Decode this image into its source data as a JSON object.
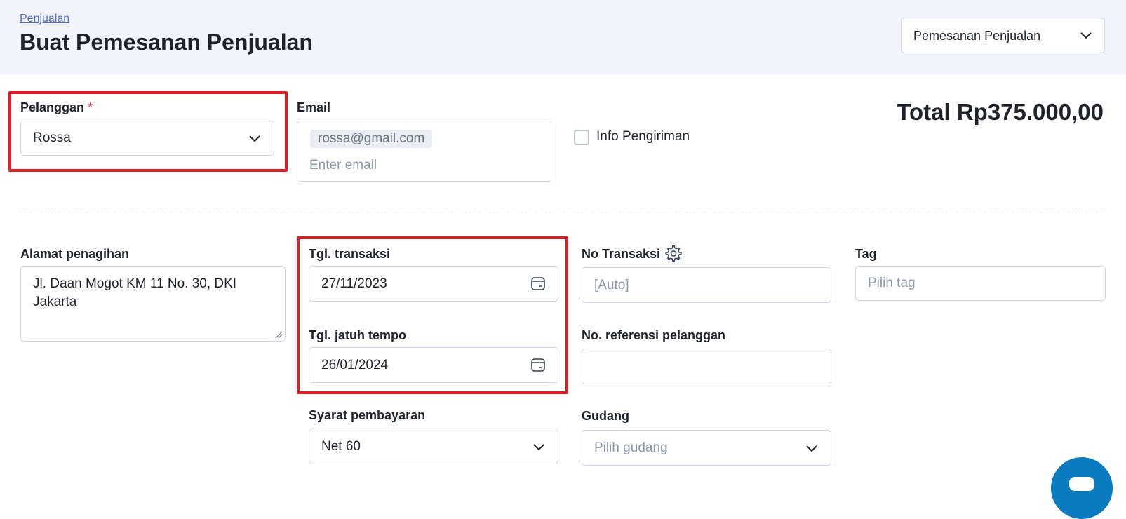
{
  "header": {
    "breadcrumb": "Penjualan",
    "title": "Buat Pemesanan Penjualan",
    "type_select": "Pemesanan Penjualan"
  },
  "customer": {
    "label": "Pelanggan",
    "required_mark": "*",
    "value": "Rossa"
  },
  "email": {
    "label": "Email",
    "chip": "rossa@gmail.com",
    "placeholder": "Enter email"
  },
  "shipping": {
    "label": "Info Pengiriman",
    "checked": false
  },
  "total": "Total Rp375.000,00",
  "billing": {
    "label": "Alamat penagihan",
    "value": "Jl. Daan Mogot KM 11 No. 30, DKI Jakarta"
  },
  "transaction_date": {
    "label": "Tgl. transaksi",
    "value": "27/11/2023"
  },
  "due_date": {
    "label": "Tgl. jatuh tempo",
    "value": "26/01/2024"
  },
  "payment_terms": {
    "label": "Syarat pembayaran",
    "value": "Net 60"
  },
  "transaction_no": {
    "label": "No Transaksi",
    "placeholder": "[Auto]"
  },
  "customer_ref": {
    "label": "No. referensi pelanggan",
    "value": ""
  },
  "warehouse": {
    "label": "Gudang",
    "placeholder": "Pilih gudang"
  },
  "tag": {
    "label": "Tag",
    "placeholder": "Pilih tag"
  },
  "colors": {
    "highlight": "#e01e26",
    "link": "#4f6bd1",
    "fab": "#0a7bbf",
    "header_bg": "#f1f5fb"
  }
}
